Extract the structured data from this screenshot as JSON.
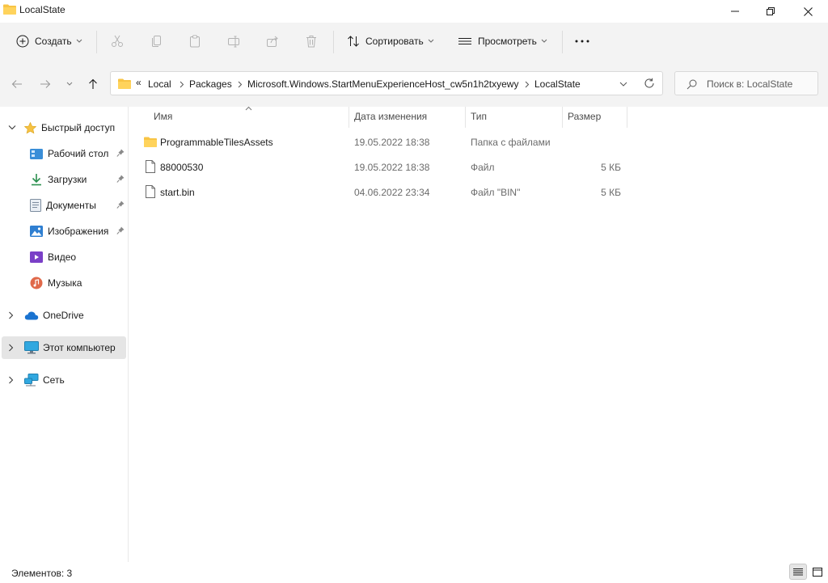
{
  "window": {
    "title": "LocalState"
  },
  "toolbar": {
    "new_label": "Создать",
    "sort_label": "Сортировать",
    "view_label": "Просмотреть"
  },
  "address": {
    "overflow": "«",
    "crumbs": [
      "Local",
      "Packages",
      "Microsoft.Windows.StartMenuExperienceHost_cw5n1h2txyewy",
      "LocalState"
    ]
  },
  "search": {
    "placeholder": "Поиск в: LocalState"
  },
  "sidebar": {
    "quick_access": "Быстрый доступ",
    "items": [
      {
        "label": "Рабочий стол"
      },
      {
        "label": "Загрузки"
      },
      {
        "label": "Документы"
      },
      {
        "label": "Изображения"
      },
      {
        "label": "Видео"
      },
      {
        "label": "Музыка"
      }
    ],
    "onedrive": "OneDrive",
    "this_pc": "Этот компьютер",
    "network": "Сеть"
  },
  "columns": {
    "name": "Имя",
    "date": "Дата изменения",
    "type": "Тип",
    "size": "Размер"
  },
  "files": [
    {
      "name": "ProgrammableTilesAssets",
      "date": "19.05.2022 18:38",
      "type": "Папка с файлами",
      "size": ""
    },
    {
      "name": "88000530",
      "date": "19.05.2022 18:38",
      "type": "Файл",
      "size": "5 КБ"
    },
    {
      "name": "start.bin",
      "date": "04.06.2022 23:34",
      "type": "Файл \"BIN\"",
      "size": "5 КБ"
    }
  ],
  "status": {
    "items_count": "Элементов: 3"
  },
  "colors": {
    "folder": "#f8c445",
    "accent": "#0067c0",
    "selection": "#e5e5e5"
  }
}
